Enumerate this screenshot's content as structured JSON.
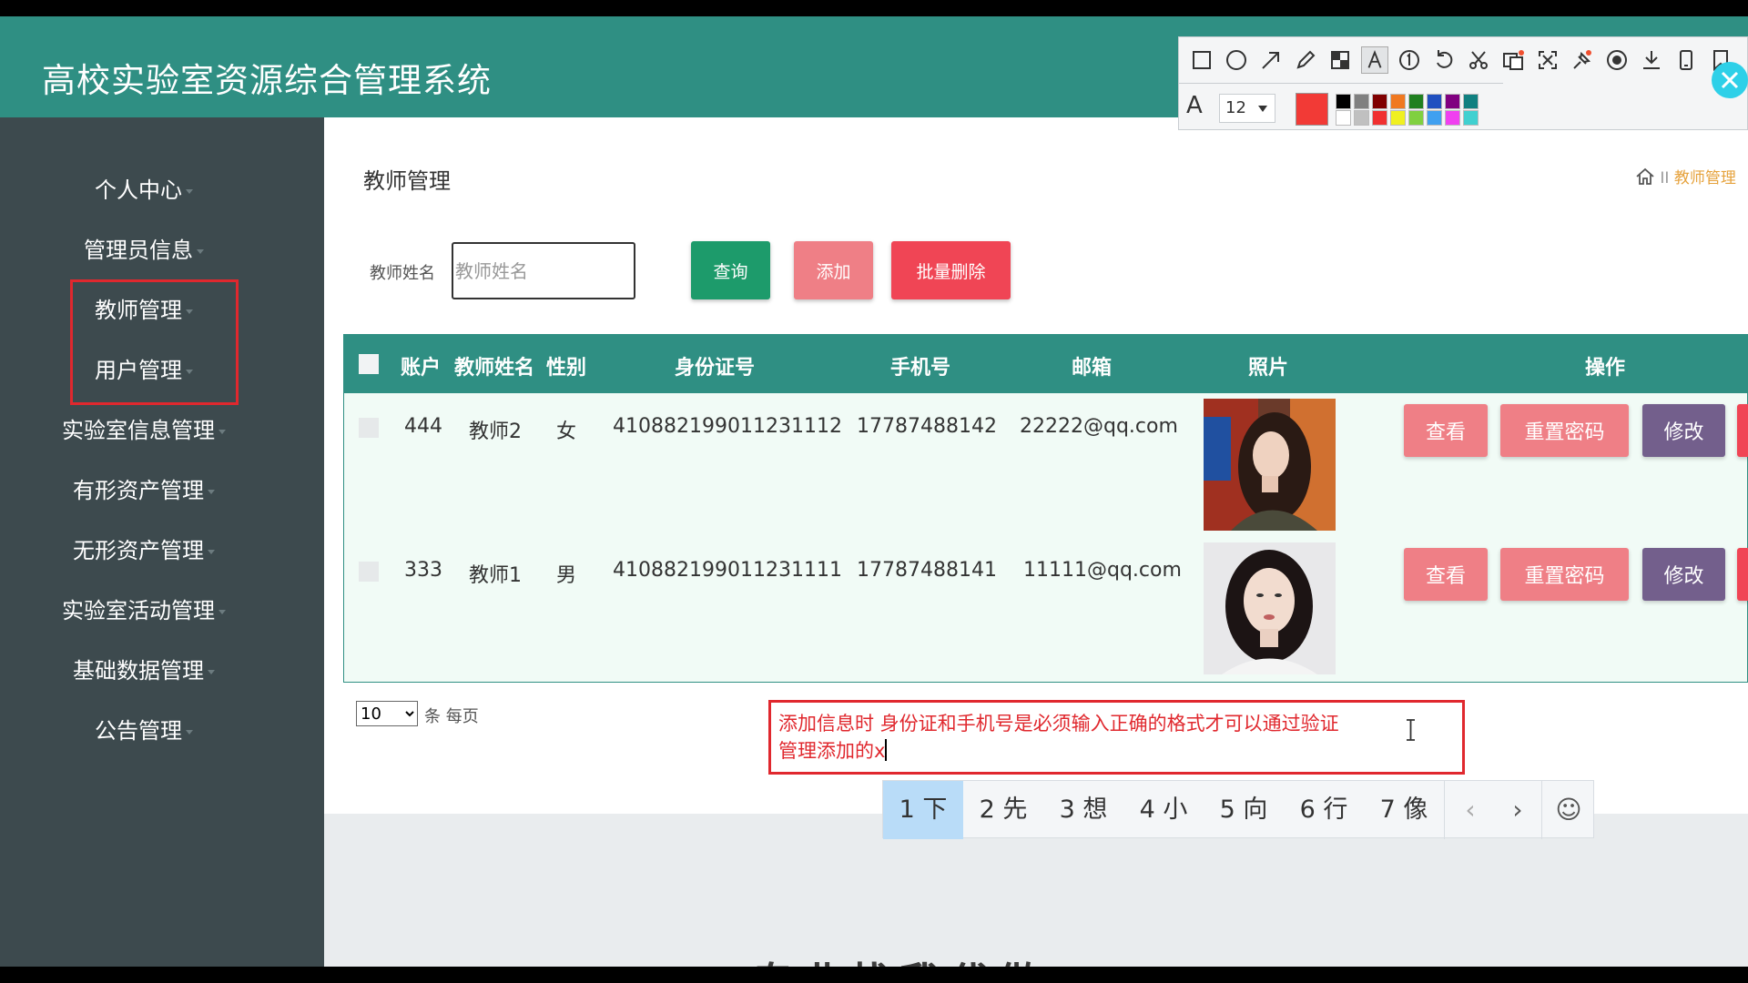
{
  "app": {
    "title": "高校实验室资源综合管理系统"
  },
  "sidebar": {
    "items": [
      {
        "label": "个人中心"
      },
      {
        "label": "管理员信息"
      },
      {
        "label": "教师管理"
      },
      {
        "label": "用户管理"
      },
      {
        "label": "实验室信息管理"
      },
      {
        "label": "有形资产管理"
      },
      {
        "label": "无形资产管理"
      },
      {
        "label": "实验室活动管理"
      },
      {
        "label": "基础数据管理"
      },
      {
        "label": "公告管理"
      }
    ]
  },
  "main": {
    "heading": "教师管理",
    "breadcrumb": {
      "separator": "II",
      "current": "教师管理"
    },
    "search": {
      "label": "教师姓名",
      "placeholder": "教师姓名",
      "value": ""
    },
    "buttons": {
      "query": "查询",
      "add": "添加",
      "batch_delete": "批量删除"
    },
    "table": {
      "headers": {
        "account": "账户",
        "name": "教师姓名",
        "gender": "性别",
        "id_number": "身份证号",
        "phone": "手机号",
        "email": "邮箱",
        "photo": "照片",
        "actions": "操作"
      },
      "rows": [
        {
          "account": "444",
          "name": "教师2",
          "gender": "女",
          "id_number": "410882199011231112",
          "phone": "17787488142",
          "email": "22222@qq.com"
        },
        {
          "account": "333",
          "name": "教师1",
          "gender": "男",
          "id_number": "410882199011231111",
          "phone": "17787488141",
          "email": "11111@qq.com"
        }
      ],
      "row_actions": {
        "view": "查看",
        "reset_password": "重置密码",
        "edit": "修改"
      }
    },
    "pager": {
      "page_size": "10",
      "per_page_text": "条 每页"
    }
  },
  "annotation": {
    "line1": "添加信息时 身份证和手机号是必须输入正确的格式才可以通过验证",
    "line2": "管理添加的x"
  },
  "ime": {
    "candidates": [
      "1 下",
      "2 先",
      "3 想",
      "4 小",
      "5 向",
      "6 行",
      "7 像"
    ],
    "prev": "‹",
    "next": "›",
    "emoji": "☺"
  },
  "toolbar": {
    "font_size": "12",
    "font_label": "A",
    "current_color": "#f23a36",
    "swatches_top": [
      "#000000",
      "#808080",
      "#800000",
      "#f07820",
      "#208020",
      "#2050c0",
      "#800080",
      "#108080"
    ],
    "swatches_bottom": [
      "#ffffff",
      "#c0c0c0",
      "#f03030",
      "#f0f020",
      "#80d040",
      "#40a0f0",
      "#f040f0",
      "#40d0d0"
    ]
  },
  "colors": {
    "header": "#2f8f83",
    "sidebar": "#3d4a4e",
    "accent_red": "#e0282e"
  },
  "footer_partial_text": "专业找我代做"
}
